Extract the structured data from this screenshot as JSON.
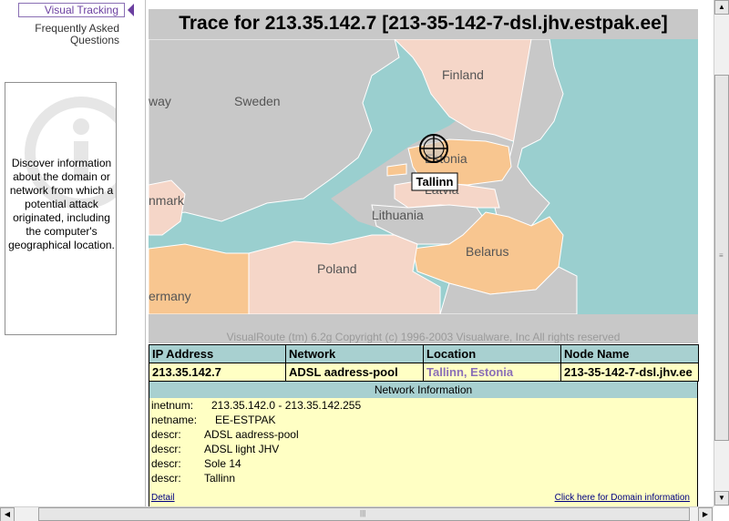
{
  "sidebar": {
    "active_item": "Visual Tracking",
    "items": [
      {
        "label": "Frequently Asked Questions"
      }
    ],
    "info_text": "Discover information about the domain or network from which a potential attack originated, including the computer's geographical location."
  },
  "trace": {
    "title": "Trace for 213.35.142.7 [213-35-142-7-dsl.jhv.estpak.ee]"
  },
  "map": {
    "labels": {
      "finland": "Finland",
      "sweden": "Sweden",
      "norway": "way",
      "estonia": "Estonia",
      "latvia": "Latvia",
      "lithuania": "Lithuania",
      "denmark": "nmark",
      "belarus": "Belarus",
      "poland": "Poland",
      "germany": "ermany"
    },
    "marker_label": "Tallinn",
    "colors": {
      "sea": "#9acfcf",
      "land_pink": "#f5d6c8",
      "land_orange": "#f8c690",
      "land_grey": "#c8c8c8"
    }
  },
  "copyright": "VisualRoute (tm) 6.2g Copyright (c) 1996-2003 Visualware, Inc  All rights reserved",
  "table": {
    "headers": [
      "IP Address",
      "Network",
      "Location",
      "Node Name"
    ],
    "row": [
      "213.35.142.7",
      "ADSL aadress-pool",
      "Tallinn, Estonia",
      "213-35-142-7-dsl.jhv.ee"
    ]
  },
  "network_info": {
    "header": "Network Information",
    "rows": [
      {
        "key": "inetnum:",
        "value": "213.35.142.0 - 213.35.142.255"
      },
      {
        "key": "netname:",
        "value": "EE-ESTPAK"
      },
      {
        "key": "descr:",
        "value": "ADSL aadress-pool"
      },
      {
        "key": "descr:",
        "value": "ADSL light JHV"
      },
      {
        "key": "descr:",
        "value": "Sole 14"
      },
      {
        "key": "descr:",
        "value": "Tallinn"
      }
    ],
    "detail_link": "Detail",
    "domain_link": "Click here for Domain information"
  }
}
